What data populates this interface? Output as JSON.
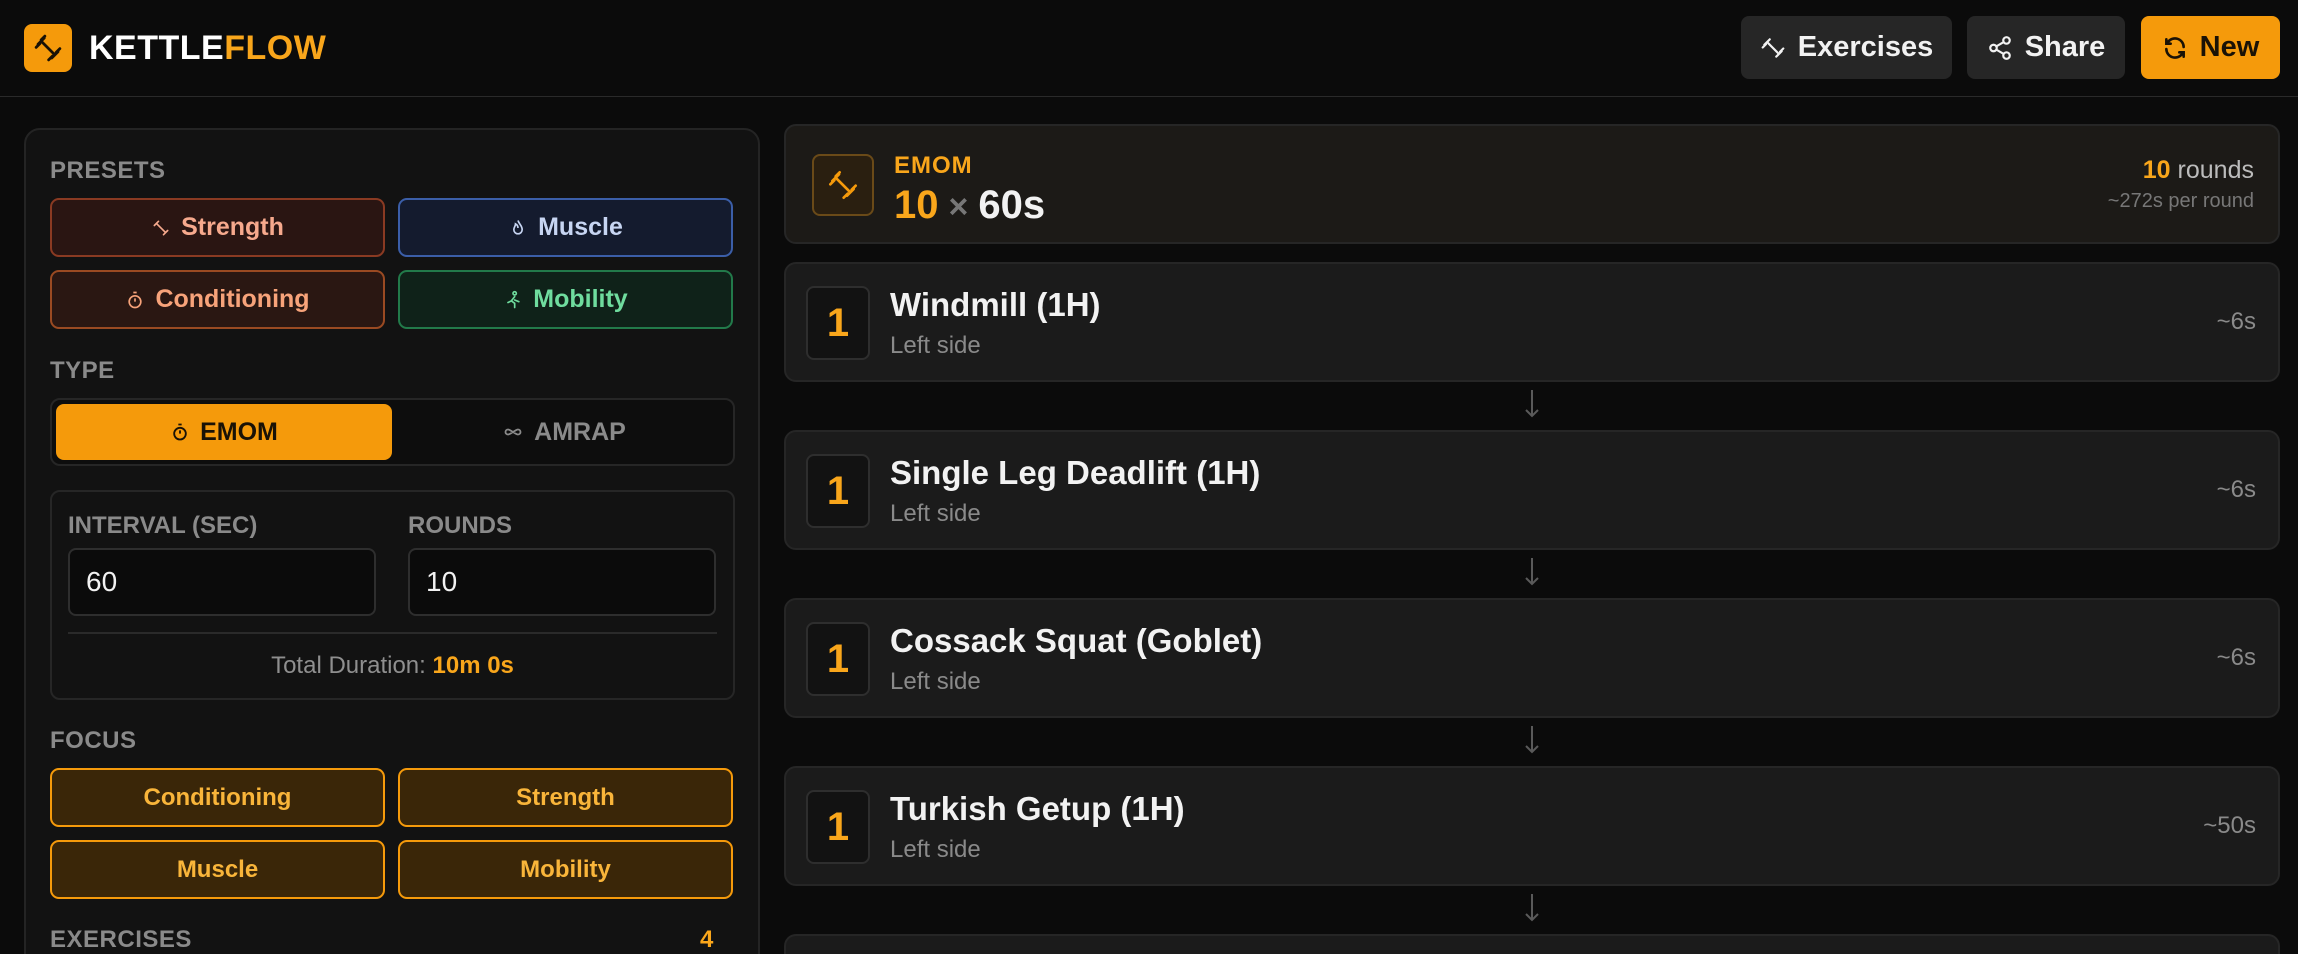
{
  "app": {
    "name_part1": "KETTLE",
    "name_part2": "FLOW",
    "accent": "#f59a0b"
  },
  "header": {
    "buttons": [
      {
        "label": "Exercises",
        "icon": "dumbbell-icon"
      },
      {
        "label": "Share",
        "icon": "share-icon"
      },
      {
        "label": "New",
        "icon": "refresh-icon"
      }
    ]
  },
  "sidebar": {
    "presets_label": "PRESETS",
    "presets": [
      {
        "label": "Strength",
        "icon": "dumbbell-icon",
        "color": "#f6a98d"
      },
      {
        "label": "Muscle",
        "icon": "flame-icon",
        "color": "#c7d5f2"
      },
      {
        "label": "Conditioning",
        "icon": "timer-icon",
        "color": "#f7a37a"
      },
      {
        "label": "Mobility",
        "icon": "stretch-icon",
        "color": "#6fdc9e"
      }
    ],
    "type_label": "TYPE",
    "types": [
      {
        "label": "EMOM",
        "icon": "timer-icon",
        "active": true
      },
      {
        "label": "AMRAP",
        "icon": "infinity-icon",
        "active": false
      }
    ],
    "interval_label": "INTERVAL (SEC)",
    "interval_value": "60",
    "rounds_label": "ROUNDS",
    "rounds_value": "10",
    "total_label": "Total Duration:",
    "total_value": "10m 0s",
    "focus_label": "FOCUS",
    "focus": [
      "Conditioning",
      "Strength",
      "Muscle",
      "Mobility"
    ],
    "exercises_label": "EXERCISES",
    "exercises_count": "4"
  },
  "summary": {
    "type": "EMOM",
    "rounds_count": "10",
    "times_symbol": "×",
    "interval": "60s",
    "rounds_word": "rounds",
    "per_round": "~272s per round"
  },
  "exercises": [
    {
      "num": "1",
      "name": "Windmill (1H)",
      "side": "Left side",
      "time": "~6s"
    },
    {
      "num": "1",
      "name": "Single Leg Deadlift (1H)",
      "side": "Left side",
      "time": "~6s"
    },
    {
      "num": "1",
      "name": "Cossack Squat (Goblet)",
      "side": "Left side",
      "time": "~6s"
    },
    {
      "num": "1",
      "name": "Turkish Getup (1H)",
      "side": "Left side",
      "time": "~50s"
    }
  ]
}
